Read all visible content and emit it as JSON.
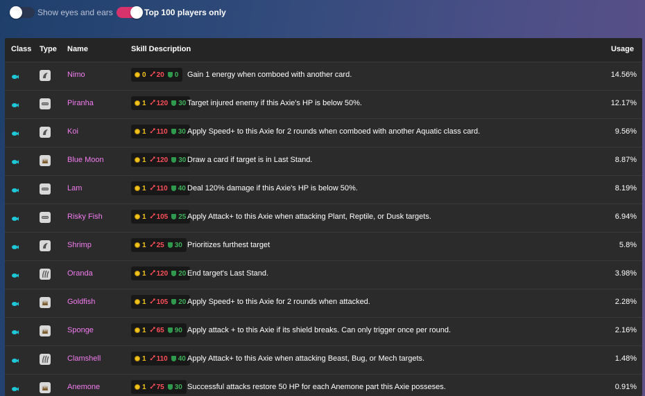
{
  "filters": {
    "show_eyes_ears": {
      "label": "Show eyes and ears",
      "enabled": false
    },
    "top100": {
      "label": "Top 100 players only",
      "enabled": true
    }
  },
  "table": {
    "headers": {
      "class": "Class",
      "type": "Type",
      "name": "Name",
      "skill": "Skill Description",
      "usage": "Usage"
    },
    "rows": [
      {
        "class_icon": "fish-icon",
        "type_icon": "horn-icon",
        "name": "Nimo",
        "energy": "0",
        "attack": "20",
        "shield": "0",
        "desc": "Gain 1 energy when comboed with another card.",
        "usage": "14.56%"
      },
      {
        "class_icon": "fish-icon",
        "type_icon": "mouth-icon",
        "name": "Piranha",
        "energy": "1",
        "attack": "120",
        "shield": "30",
        "desc": "Target injured enemy if this Axie's HP is below 50%.",
        "usage": "12.17%"
      },
      {
        "class_icon": "fish-icon",
        "type_icon": "horn-icon",
        "name": "Koi",
        "energy": "1",
        "attack": "110",
        "shield": "30",
        "desc": "Apply Speed+ to this Axie for 2 rounds when comboed with another Aquatic class card.",
        "usage": "9.56%"
      },
      {
        "class_icon": "fish-icon",
        "type_icon": "back-icon",
        "name": "Blue Moon",
        "energy": "1",
        "attack": "120",
        "shield": "30",
        "desc": "Draw a card if target is in Last Stand.",
        "usage": "8.87%"
      },
      {
        "class_icon": "fish-icon",
        "type_icon": "mouth-icon",
        "name": "Lam",
        "energy": "1",
        "attack": "110",
        "shield": "40",
        "desc": "Deal 120% damage if this Axie's HP is below 50%.",
        "usage": "8.19%"
      },
      {
        "class_icon": "fish-icon",
        "type_icon": "mouth-icon",
        "name": "Risky Fish",
        "energy": "1",
        "attack": "105",
        "shield": "25",
        "desc": "Apply Attack+ to this Axie when attacking Plant, Reptile, or Dusk targets.",
        "usage": "6.94%"
      },
      {
        "class_icon": "fish-icon",
        "type_icon": "horn-icon",
        "name": "Shrimp",
        "energy": "1",
        "attack": "25",
        "shield": "30",
        "desc": "Prioritizes furthest target",
        "usage": "5.8%"
      },
      {
        "class_icon": "fish-icon",
        "type_icon": "tail-icon",
        "name": "Oranda",
        "energy": "1",
        "attack": "120",
        "shield": "20",
        "desc": "End target's Last Stand.",
        "usage": "3.98%"
      },
      {
        "class_icon": "fish-icon",
        "type_icon": "back-icon",
        "name": "Goldfish",
        "energy": "1",
        "attack": "105",
        "shield": "20",
        "desc": "Apply Speed+ to this Axie for 2 rounds when attacked.",
        "usage": "2.28%"
      },
      {
        "class_icon": "fish-icon",
        "type_icon": "back-icon",
        "name": "Sponge",
        "energy": "1",
        "attack": "65",
        "shield": "90",
        "desc": "Apply attack + to this Axie if its shield breaks. Can only trigger once per round.",
        "usage": "2.16%"
      },
      {
        "class_icon": "fish-icon",
        "type_icon": "tail-icon",
        "name": "Clamshell",
        "energy": "1",
        "attack": "110",
        "shield": "40",
        "desc": "Apply Attack+ to this Axie when attacking Beast, Bug, or Mech targets.",
        "usage": "1.48%"
      },
      {
        "class_icon": "fish-icon",
        "type_icon": "back-icon",
        "name": "Anemone",
        "energy": "1",
        "attack": "75",
        "shield": "30",
        "desc": "Successful attacks restore 50 HP for each Anemone part this Axie posseses.",
        "usage": "0.91%"
      }
    ]
  },
  "colors": {
    "name": "#f37cf0",
    "class_icon": "#1ec8d8",
    "energy": "#f5c518",
    "attack": "#ff4f5a",
    "shield": "#3fb05a",
    "toggle_on": "#d6336c"
  }
}
